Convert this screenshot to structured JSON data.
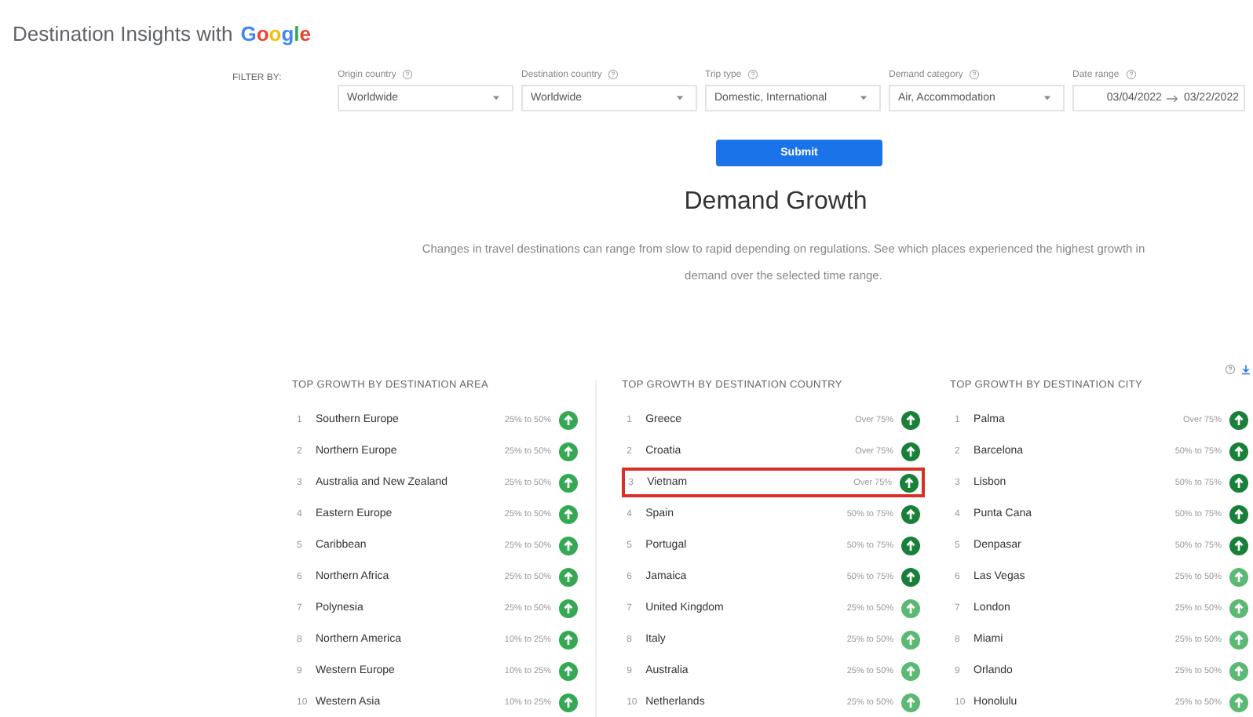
{
  "header": {
    "title": "Destination Insights with",
    "logo": "Google"
  },
  "filters": {
    "label": "FILTER BY:",
    "fields": [
      {
        "kind": "select",
        "label": "Origin country",
        "value": "Worldwide"
      },
      {
        "kind": "select",
        "label": "Destination country",
        "value": "Worldwide"
      },
      {
        "kind": "select",
        "label": "Trip type",
        "value": "Domestic, International"
      },
      {
        "kind": "select",
        "label": "Demand category",
        "value": "Air, Accommodation"
      },
      {
        "kind": "daterange",
        "label": "Date range",
        "start": "03/04/2022",
        "end": "03/22/2022"
      }
    ],
    "submit": "Submit"
  },
  "section": {
    "title": "Demand Growth",
    "description": "Changes in travel destinations can range from slow to rapid depending on regulations. See which places experienced the highest growth in demand over the selected time range."
  },
  "lists": [
    {
      "title": "TOP GROWTH BY DESTINATION AREA",
      "items": [
        {
          "rank": "1",
          "name": "Southern Europe",
          "range": "25% to 50%",
          "color": "#34a853",
          "highlighted": false
        },
        {
          "rank": "2",
          "name": "Northern Europe",
          "range": "25% to 50%",
          "color": "#34a853",
          "highlighted": false
        },
        {
          "rank": "3",
          "name": "Australia and New Zealand",
          "range": "25% to 50%",
          "color": "#34a853",
          "highlighted": false
        },
        {
          "rank": "4",
          "name": "Eastern Europe",
          "range": "25% to 50%",
          "color": "#34a853",
          "highlighted": false
        },
        {
          "rank": "5",
          "name": "Caribbean",
          "range": "25% to 50%",
          "color": "#34a853",
          "highlighted": false
        },
        {
          "rank": "6",
          "name": "Northern Africa",
          "range": "25% to 50%",
          "color": "#34a853",
          "highlighted": false
        },
        {
          "rank": "7",
          "name": "Polynesia",
          "range": "25% to 50%",
          "color": "#34a853",
          "highlighted": false
        },
        {
          "rank": "8",
          "name": "Northern America",
          "range": "10% to 25%",
          "color": "#34a853",
          "highlighted": false
        },
        {
          "rank": "9",
          "name": "Western Europe",
          "range": "10% to 25%",
          "color": "#34a853",
          "highlighted": false
        },
        {
          "rank": "10",
          "name": "Western Asia",
          "range": "10% to 25%",
          "color": "#34a853",
          "highlighted": false
        }
      ]
    },
    {
      "title": "TOP GROWTH BY DESTINATION COUNTRY",
      "items": [
        {
          "rank": "1",
          "name": "Greece",
          "range": "Over 75%",
          "color": "#188038",
          "highlighted": false
        },
        {
          "rank": "2",
          "name": "Croatia",
          "range": "Over 75%",
          "color": "#188038",
          "highlighted": false
        },
        {
          "rank": "3",
          "name": "Vietnam",
          "range": "Over 75%",
          "color": "#188038",
          "highlighted": true
        },
        {
          "rank": "4",
          "name": "Spain",
          "range": "50% to 75%",
          "color": "#188038",
          "highlighted": false
        },
        {
          "rank": "5",
          "name": "Portugal",
          "range": "50% to 75%",
          "color": "#188038",
          "highlighted": false
        },
        {
          "rank": "6",
          "name": "Jamaica",
          "range": "50% to 75%",
          "color": "#188038",
          "highlighted": false
        },
        {
          "rank": "7",
          "name": "United Kingdom",
          "range": "25% to 50%",
          "color": "#5bb974",
          "highlighted": false
        },
        {
          "rank": "8",
          "name": "Italy",
          "range": "25% to 50%",
          "color": "#5bb974",
          "highlighted": false
        },
        {
          "rank": "9",
          "name": "Australia",
          "range": "25% to 50%",
          "color": "#5bb974",
          "highlighted": false
        },
        {
          "rank": "10",
          "name": "Netherlands",
          "range": "25% to 50%",
          "color": "#5bb974",
          "highlighted": false
        }
      ]
    },
    {
      "title": "TOP GROWTH BY DESTINATION CITY",
      "items": [
        {
          "rank": "1",
          "name": "Palma",
          "range": "Over 75%",
          "color": "#188038",
          "highlighted": false
        },
        {
          "rank": "2",
          "name": "Barcelona",
          "range": "50% to 75%",
          "color": "#188038",
          "highlighted": false
        },
        {
          "rank": "3",
          "name": "Lisbon",
          "range": "50% to 75%",
          "color": "#188038",
          "highlighted": false
        },
        {
          "rank": "4",
          "name": "Punta Cana",
          "range": "50% to 75%",
          "color": "#188038",
          "highlighted": false
        },
        {
          "rank": "5",
          "name": "Denpasar",
          "range": "50% to 75%",
          "color": "#188038",
          "highlighted": false
        },
        {
          "rank": "6",
          "name": "Las Vegas",
          "range": "25% to 50%",
          "color": "#5bb974",
          "highlighted": false
        },
        {
          "rank": "7",
          "name": "London",
          "range": "25% to 50%",
          "color": "#5bb974",
          "highlighted": false
        },
        {
          "rank": "8",
          "name": "Miami",
          "range": "25% to 50%",
          "color": "#5bb974",
          "highlighted": false
        },
        {
          "rank": "9",
          "name": "Orlando",
          "range": "25% to 50%",
          "color": "#5bb974",
          "highlighted": false
        },
        {
          "rank": "10",
          "name": "Honolulu",
          "range": "25% to 50%",
          "color": "#5bb974",
          "highlighted": false
        }
      ]
    }
  ]
}
